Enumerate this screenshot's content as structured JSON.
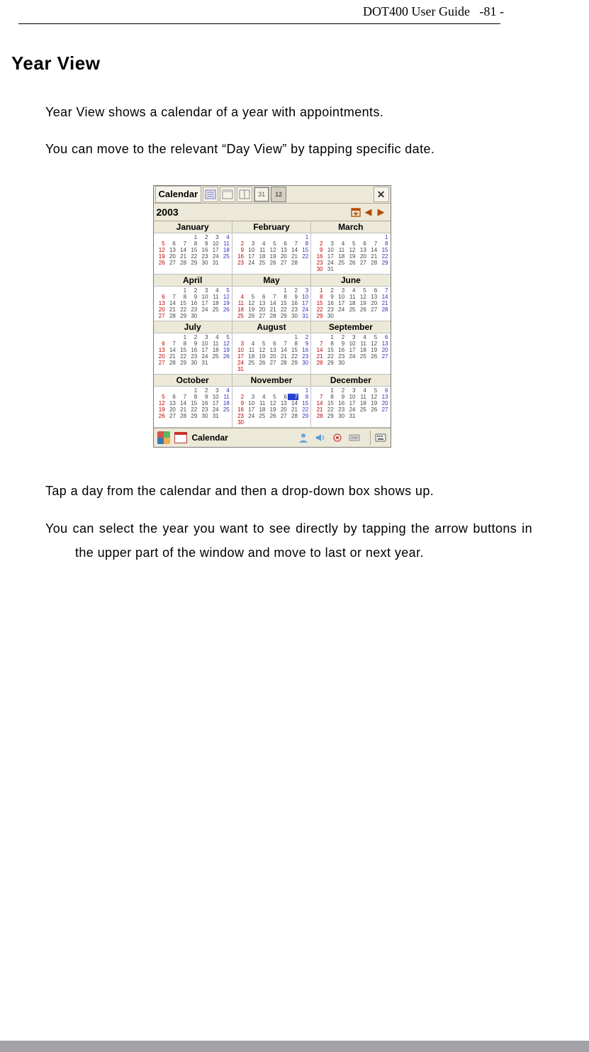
{
  "header": {
    "doc_title": "DOT400 User Guide",
    "page_no": "-81 -"
  },
  "section_title": "Year View",
  "para1": "Year View shows a calendar of a year with appointments.",
  "para2": "You can move to the relevant “Day View” by tapping specific date.",
  "para3": "Tap a day from the calendar and then a drop-down box shows up.",
  "para4": "You can select the year you want to see directly by tapping the arrow buttons in the upper part of the window and move to last or next year.",
  "device": {
    "app_name": "Calendar",
    "year": "2003",
    "view_icons": {
      "agenda": "agenda",
      "day": "day",
      "week": "week",
      "month31": "31",
      "year": "12"
    },
    "close_label": "✕",
    "nav": {
      "today_label": "today",
      "prev_label": "◀",
      "next_label": "▶"
    },
    "months": [
      "January",
      "February",
      "March",
      "April",
      "May",
      "June",
      "July",
      "August",
      "September",
      "October",
      "November",
      "December"
    ],
    "days_in_month": [
      31,
      28,
      31,
      30,
      31,
      30,
      31,
      31,
      30,
      31,
      30,
      31
    ],
    "first_weekday": [
      3,
      6,
      6,
      2,
      4,
      0,
      2,
      5,
      1,
      3,
      6,
      1
    ],
    "today": {
      "month_index": 10,
      "day": 7
    },
    "bottom_bar_label": "Calendar"
  }
}
